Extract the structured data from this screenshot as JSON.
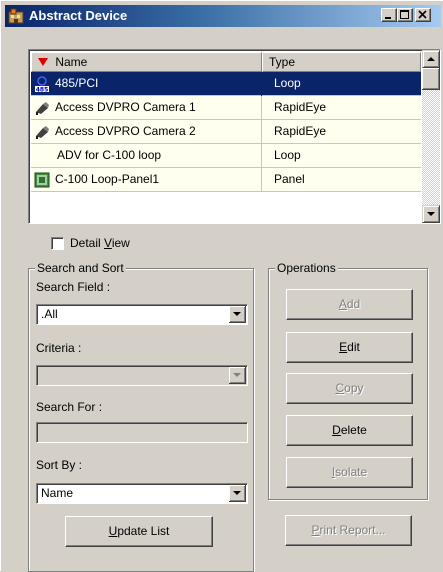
{
  "window": {
    "title": "Abstract Device",
    "minimize_icon": "minimize-icon",
    "maximize_icon": "maximize-icon",
    "close_icon": "close-icon"
  },
  "list": {
    "columns": [
      {
        "label": "Name",
        "sort": "descending"
      },
      {
        "label": "Type"
      }
    ],
    "rows": [
      {
        "name": "485/PCI",
        "type": "Loop",
        "icon": "485-loop-icon",
        "selected": true
      },
      {
        "name": "Access DVPRO Camera 1",
        "type": "RapidEye",
        "icon": "camera-icon"
      },
      {
        "name": "Access DVPRO Camera 2",
        "type": "RapidEye",
        "icon": "camera-icon"
      },
      {
        "name": "ADV for C-100 loop",
        "type": "Loop",
        "icon": ""
      },
      {
        "name": "C-100 Loop-Panel1",
        "type": "Panel",
        "icon": "panel-icon"
      }
    ]
  },
  "detail_view": {
    "label_pre": "Detail ",
    "label_accel": "V",
    "label_post": "iew",
    "checked": false
  },
  "search_sort": {
    "legend": "Search and Sort",
    "search_field_label": "Search Field :",
    "search_field_value": ".All",
    "criteria_label": "Criteria :",
    "criteria_value": "",
    "search_for_label": "Search For :",
    "search_for_value": "",
    "sort_by_label": "Sort By :",
    "sort_by_value": "Name",
    "update_list": {
      "accel": "U",
      "rest": "pdate List"
    }
  },
  "operations": {
    "legend": "Operations",
    "add": {
      "accel": "A",
      "rest": "dd",
      "enabled": false
    },
    "edit": {
      "accel": "E",
      "rest": "dit",
      "enabled": true
    },
    "copy": {
      "accel": "C",
      "rest": "opy",
      "enabled": false
    },
    "delete": {
      "accel": "D",
      "rest": "elete",
      "enabled": true
    },
    "isolate": {
      "accel": "I",
      "rest": "solate",
      "enabled": false
    },
    "print_report": {
      "accel": "P",
      "rest": "rint Report...",
      "enabled": false
    }
  },
  "colors": {
    "title_bar": "#0a246a",
    "selection": "#0a246a",
    "row_background": "#fffff0",
    "face": "#d4d0c8",
    "sort_arrow": "#e00000"
  }
}
